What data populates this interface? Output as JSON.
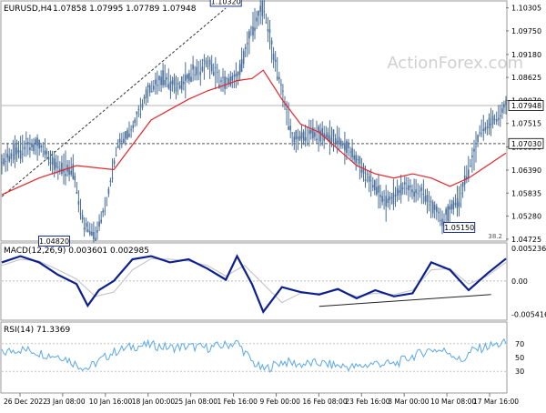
{
  "header": {
    "symbol": "EURUSD,H4",
    "ohlc": "1.07858 1.07995 1.07789 1.07948"
  },
  "watermark": "ActionForex.com",
  "colors": {
    "candle": "#4a6f9a",
    "ma": "#e3262a",
    "macd": "#0b1f8f",
    "signal": "#c9c9cc",
    "rsi": "#5aa9e6",
    "grid": "#d9d9d9",
    "label_border": "#1b2f8a",
    "text": "#000000"
  },
  "chart_data": [
    {
      "type": "line",
      "panel": "price",
      "ylim": [
        1.047,
        1.1045
      ],
      "y_ticks": [
        "1.10305",
        "1.09750",
        "1.09180",
        "1.08625",
        "1.08070",
        "1.07515",
        "1.06950",
        "1.06390",
        "1.05835",
        "1.05280",
        "1.04725"
      ],
      "x_ticks": [
        "26 Dec 2022",
        "3 Jan 08:00",
        "10 Jan 16:00",
        "18 Jan 00:00",
        "25 Jan 08:00",
        "1 Feb 16:00",
        "9 Feb 00:00",
        "16 Feb 08:00",
        "23 Feb 16:00",
        "3 Mar 00:00",
        "10 Mar 08:00",
        "17 Mar 16:00"
      ],
      "x_range": [
        0,
        270
      ],
      "series": [
        {
          "role": "price",
          "x": [
            0,
            10,
            20,
            30,
            38,
            44,
            50,
            56,
            62,
            70,
            78,
            86,
            94,
            102,
            110,
            118,
            126,
            134,
            140,
            148,
            156,
            166,
            176,
            186,
            196,
            206,
            216,
            226,
            236,
            246,
            256,
            266,
            270
          ],
          "y": [
            1.066,
            1.069,
            1.07,
            1.0645,
            1.064,
            1.051,
            1.0482,
            1.056,
            1.07,
            1.074,
            1.083,
            1.086,
            1.084,
            1.087,
            1.09,
            1.085,
            1.086,
            1.098,
            1.1032,
            1.087,
            1.071,
            1.073,
            1.072,
            1.069,
            1.062,
            1.056,
            1.06,
            1.058,
            1.0515,
            1.058,
            1.073,
            1.077,
            1.0795
          ]
        },
        {
          "role": "moving-average",
          "x": [
            0,
            20,
            40,
            60,
            80,
            100,
            110,
            120,
            126,
            134,
            140,
            150,
            160,
            170,
            180,
            190,
            200,
            210,
            220,
            230,
            240,
            250,
            260,
            270
          ],
          "y": [
            1.058,
            1.062,
            1.065,
            1.064,
            1.076,
            1.081,
            1.083,
            1.0845,
            1.0855,
            1.086,
            1.088,
            1.081,
            1.075,
            1.073,
            1.069,
            1.065,
            1.063,
            1.062,
            1.063,
            1.062,
            1.06,
            1.062,
            1.065,
            1.068
          ]
        }
      ],
      "annotations": [
        {
          "label": "1.10320",
          "x": 120,
          "y": 1.1032,
          "pos": "above"
        },
        {
          "label": "1.04820",
          "x": 28,
          "y": 1.0482,
          "pos": "below"
        },
        {
          "label": "1.05150",
          "x": 245,
          "y": 1.0515,
          "pos": "below"
        }
      ],
      "horizontal_lines": [
        {
          "level": 1.0703,
          "label": "1.07030",
          "style": "dashed"
        },
        {
          "level": 1.07948,
          "label": "1.07948",
          "style": "solid"
        }
      ],
      "trendline": {
        "x1": 0,
        "y1": 1.0575,
        "x2": 120,
        "y2": 1.103
      },
      "fib_label": "38.2"
    },
    {
      "type": "line",
      "panel": "macd",
      "title": "MACD(12,26,9) 0.003601 0.002985",
      "ylim": [
        -0.0062,
        0.006
      ],
      "y_ticks": [
        "0.005236",
        "0.00",
        "-0.005416"
      ],
      "x_range": [
        0,
        270
      ],
      "series": [
        {
          "role": "macd",
          "x": [
            0,
            10,
            20,
            30,
            40,
            46,
            52,
            60,
            70,
            80,
            90,
            100,
            110,
            120,
            126,
            134,
            140,
            150,
            160,
            170,
            180,
            190,
            200,
            210,
            220,
            230,
            240,
            250,
            260,
            270
          ],
          "y": [
            0.003,
            0.004,
            0.003,
            0.001,
            -0.0005,
            -0.004,
            -0.0015,
            0.0,
            0.0035,
            0.004,
            0.003,
            0.0035,
            0.002,
            0.0002,
            0.004,
            -0.0005,
            -0.005,
            -0.001,
            -0.0018,
            -0.0022,
            -0.0013,
            -0.0028,
            -0.0015,
            -0.0025,
            -0.002,
            0.003,
            0.0018,
            -0.0015,
            0.0012,
            0.0036
          ]
        },
        {
          "role": "signal",
          "x": [
            0,
            10,
            20,
            30,
            40,
            50,
            60,
            70,
            80,
            90,
            100,
            110,
            120,
            130,
            140,
            150,
            160,
            170,
            180,
            190,
            200,
            210,
            220,
            230,
            240,
            250,
            260,
            270
          ],
          "y": [
            0.0025,
            0.0035,
            0.0032,
            0.0018,
            0.0003,
            -0.0025,
            -0.0018,
            0.0018,
            0.0036,
            0.0035,
            0.0032,
            0.0025,
            0.0008,
            0.0025,
            -0.0005,
            -0.0035,
            -0.002,
            -0.002,
            -0.0015,
            -0.0025,
            -0.002,
            -0.0022,
            -0.0015,
            0.0018,
            0.002,
            -0.0005,
            0.0008,
            0.003
          ]
        }
      ],
      "trendline": {
        "x1": 170,
        "y1": -0.0041,
        "x2": 262,
        "y2": -0.0022
      }
    },
    {
      "type": "line",
      "panel": "rsi",
      "title": "RSI(14) 71.3369",
      "ylim": [
        0,
        100
      ],
      "y_ticks": [
        "70",
        "50",
        "30"
      ],
      "x_range": [
        0,
        270
      ],
      "series": [
        {
          "role": "rsi",
          "x": [
            0,
            8,
            16,
            24,
            32,
            40,
            46,
            52,
            60,
            70,
            80,
            90,
            100,
            110,
            120,
            126,
            134,
            140,
            150,
            160,
            170,
            180,
            190,
            200,
            210,
            220,
            230,
            240,
            246,
            252,
            260,
            270
          ],
          "y": [
            56,
            62,
            60,
            54,
            52,
            40,
            34,
            45,
            58,
            66,
            68,
            64,
            66,
            64,
            68,
            72,
            44,
            32,
            44,
            40,
            42,
            38,
            36,
            42,
            40,
            52,
            62,
            58,
            44,
            60,
            66,
            71
          ]
        }
      ]
    }
  ]
}
